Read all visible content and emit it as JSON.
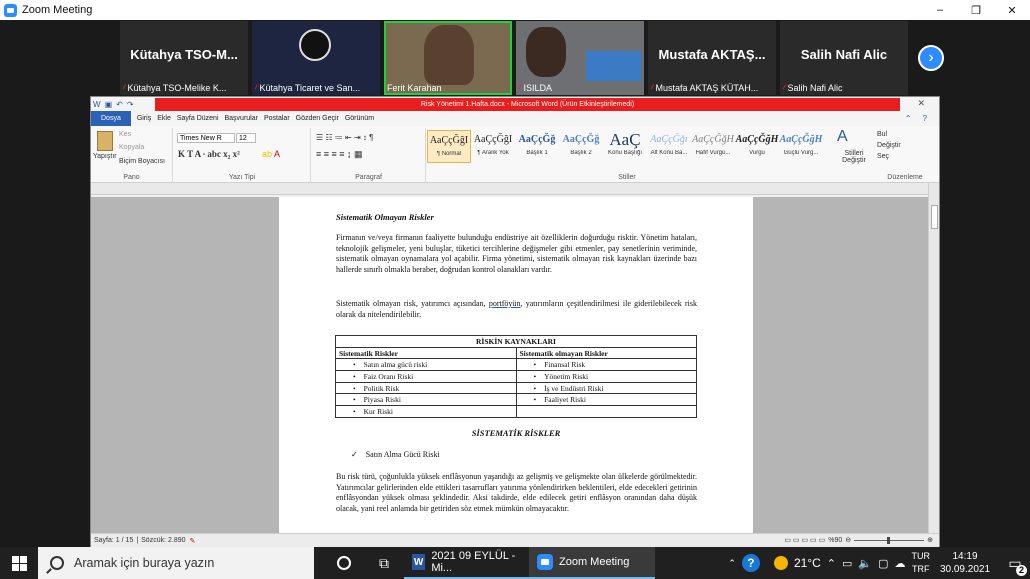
{
  "zoom": {
    "title": "Zoom Meeting",
    "window_buttons": [
      "–",
      "❐",
      "✕"
    ],
    "participants": [
      {
        "big_name": "Kütahya  TSO-M...",
        "label": "Kütahya TSO-Melike K..."
      },
      {
        "big_name": "",
        "label": "Kütahya Ticaret ve San..."
      },
      {
        "big_name": "",
        "label": "Ferit Karahan"
      },
      {
        "big_name": "",
        "label": "ISILDA"
      },
      {
        "big_name": "Mustafa  AKTAŞ...",
        "label": "Mustafa AKTAŞ KÜTAH..."
      },
      {
        "big_name": "Salih Nafi Alic",
        "label": "Salih Nafi Alic"
      }
    ],
    "next_arrow": "›"
  },
  "word": {
    "title": "Risk Yönetimi 1.Hafta.docx - Microsoft Word (Ürün Etkinleştirilemedi)",
    "tabs": [
      "Dosya",
      "Giriş",
      "Ekle",
      "Sayfa Düzeni",
      "Başvurular",
      "Postalar",
      "Gözden Geçir",
      "Görünüm"
    ],
    "clipboard": {
      "paste": "Yapıştır",
      "cut": "Kes",
      "copy": "Kopyala",
      "format_painter": "Biçim Boyacısı",
      "group": "Pano"
    },
    "font": {
      "name": "Times New R",
      "size": "12",
      "group": "Yazı Tipi"
    },
    "paragraph_group": "Paragraf",
    "styles": [
      {
        "preview": "AaÇçĞğI",
        "name": "¶ Normal"
      },
      {
        "preview": "AaÇçĞğI",
        "name": "¶ Aralık Yok"
      },
      {
        "preview": "AaÇçĞğ",
        "name": "Başlık 1"
      },
      {
        "preview": "AaÇçĞğ",
        "name": "Başlık 2"
      },
      {
        "preview": "AaÇ",
        "name": "Konu Başlığı"
      },
      {
        "preview": "AaÇçĞğı",
        "name": "Alt Konu Ba..."
      },
      {
        "preview": "AaÇçĞğH",
        "name": "Hafif Vurgu..."
      },
      {
        "preview": "AaÇçĞğH",
        "name": "Vurgu"
      },
      {
        "preview": "AaÇçĞğH",
        "name": "Güçlü Vurg..."
      }
    ],
    "styles_group": "Stiller",
    "change_styles": "Stilleri Değiştir",
    "editing": {
      "find": "Bul",
      "replace": "Değiştir",
      "select": "Seç",
      "group": "Düzenleme"
    },
    "document": {
      "heading": "Sistematik Olmayan Riskler",
      "para1": "Firmanın ve/veya firmanın faaliyette bulunduğu endüstriye ait özelliklerin doğurduğu risktir. Yönetim hataları, teknolojik gelişmeler, yeni buluşlar, tüketici tercihlerine değişmeler gibi etmenler, pay senetlerinin veriminde, sistematik olmayan oynamalara yol açabilir. Firma yönetimi, sistematik olmayan risk kaynakları üzerinde bazı hallerde sınırlı olmakla beraber, doğrudan kontrol olanakları vardır.",
      "para2_a": "Sistematik olmayan risk, yatırımcı açısından, ",
      "para2_link": "portföyün",
      "para2_b": ", yatırımların çeşitlendirilmesi ile giderilebilecek risk olarak da nitelendirilebilir.",
      "table": {
        "title": "RİSKİN KAYNAKLARI",
        "headers": [
          "Sistematik Riskler",
          "Sistematik olmayan Riskler"
        ],
        "rows": [
          [
            "Satın alma gücü riski",
            "Finansal Risk"
          ],
          [
            "Faiz Oranı Riski",
            "Yönetim Riski"
          ],
          [
            "Politik Risk",
            "İş ve Endüstri Riski"
          ],
          [
            "Piyasa Riski",
            "Faaliyet Riski"
          ],
          [
            "Kur Riski",
            ""
          ]
        ]
      },
      "section_title": "SİSTEMATİK RİSKLER",
      "check_item": "Satın Alma Gücü Riski",
      "para3": "Bu risk türü, çoğunlukla yüksek enflâsyonun yaşandığı az gelişmiş ve gelişmekte olan ülkelerde görülmektedir. Yatırımcılar gelirlerinden elde ettikleri tasarrufları yatırıma yönlendirirken beklentileri, elde edecekleri getirinin enflâsyondan yüksek olması şeklindedir. Aksi takdirde, elde edilecek getiri enflâsyon oranından daha düşük olacak, yani reel anlamda bir getiriden söz etmek mümkün olmayacaktır."
    },
    "status": {
      "page": "Sayfa: 1 / 15",
      "words": "Sözcük: 2.890",
      "zoom": "%90"
    }
  },
  "taskbar": {
    "search_placeholder": "Aramak için buraya yazın",
    "apps": [
      {
        "label": "2021 09 EYLÜL - Mi..."
      },
      {
        "label": "Zoom Meeting"
      }
    ],
    "weather": "21°C",
    "lang_top": "TUR",
    "lang_bottom": "TRF",
    "time": "14:19",
    "date": "30.09.2021",
    "notif_count": "2"
  }
}
